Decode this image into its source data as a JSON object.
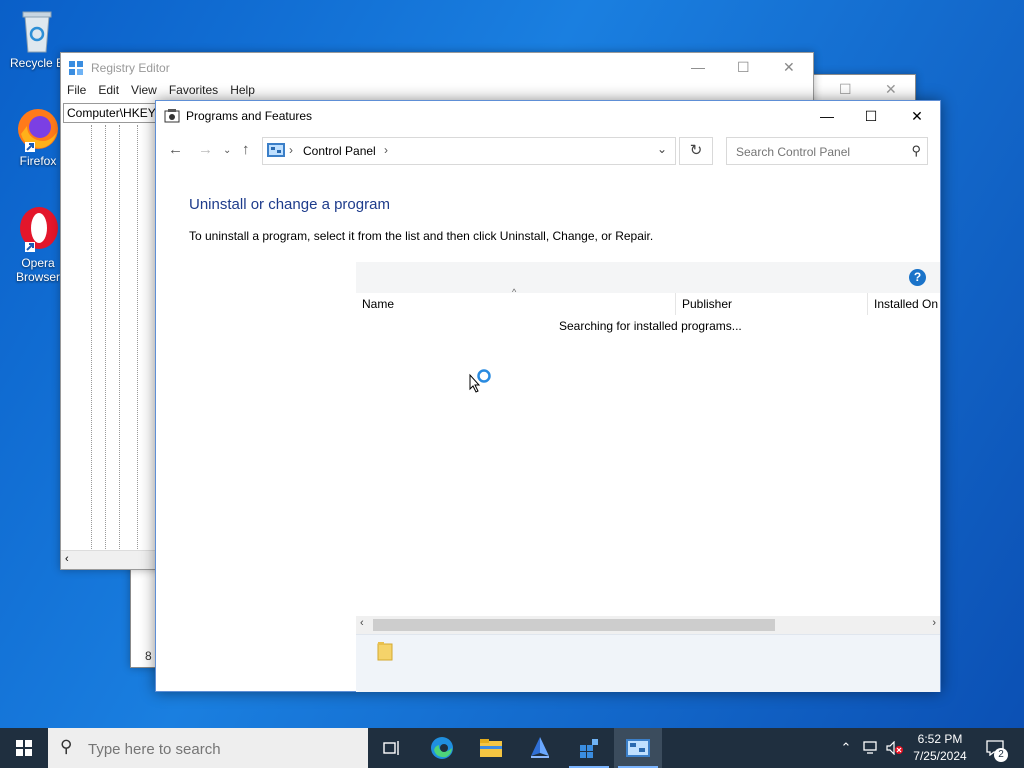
{
  "desktop": {
    "icons": [
      {
        "label": "Recycle B"
      },
      {
        "label": "Firefox"
      },
      {
        "label": "Opera Browser"
      }
    ]
  },
  "back_window": {
    "status": "8 i"
  },
  "registry": {
    "title": "Registry Editor",
    "menu": [
      "File",
      "Edit",
      "View",
      "Favorites",
      "Help"
    ],
    "address": "Computer\\HKEY_"
  },
  "programs": {
    "title": "Programs and Features",
    "breadcrumb": "Control Panel",
    "search_placeholder": "Search Control Panel",
    "heading": "Uninstall or change a program",
    "description": "To uninstall a program, select it from the list and then click Uninstall, Change, or Repair.",
    "help_label": "?",
    "columns": [
      "Name",
      "Publisher",
      "Installed On"
    ],
    "status": "Searching for installed programs..."
  },
  "taskbar": {
    "search_placeholder": "Type here to search",
    "time": "6:52 PM",
    "date": "7/25/2024",
    "notification_count": "2"
  }
}
